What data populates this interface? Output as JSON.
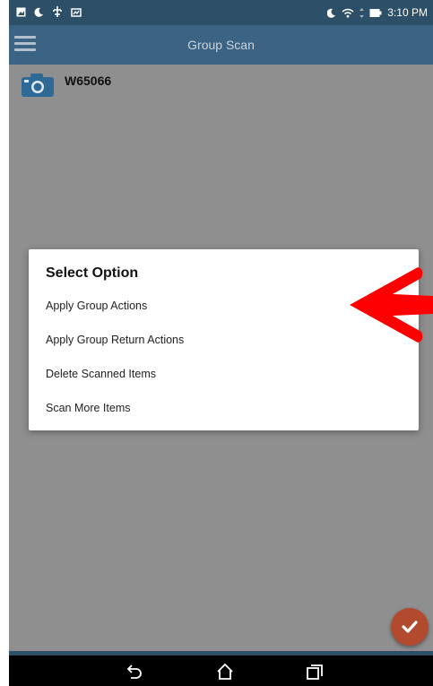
{
  "status_bar": {
    "time": "3:10 PM"
  },
  "app_bar": {
    "title": "Group Scan"
  },
  "scan_item": {
    "id": "W65066"
  },
  "dialog": {
    "title": "Select Option",
    "options": [
      {
        "label": "Apply Group Actions"
      },
      {
        "label": "Apply Group Return Actions"
      },
      {
        "label": "Delete Scanned Items"
      },
      {
        "label": "Scan More Items"
      }
    ]
  },
  "colors": {
    "status_bar": "#2d4f68",
    "app_bar": "#3b6484",
    "overlay": "#8f8f8f",
    "fab": "#b24a2f",
    "annotation_arrow": "#ff0000"
  },
  "icons": {
    "menu": "hamburger-icon",
    "scan": "camera-icon",
    "fab": "checkmark-icon",
    "nav_back": "back-icon",
    "nav_home": "home-icon",
    "nav_recents": "recents-icon"
  }
}
